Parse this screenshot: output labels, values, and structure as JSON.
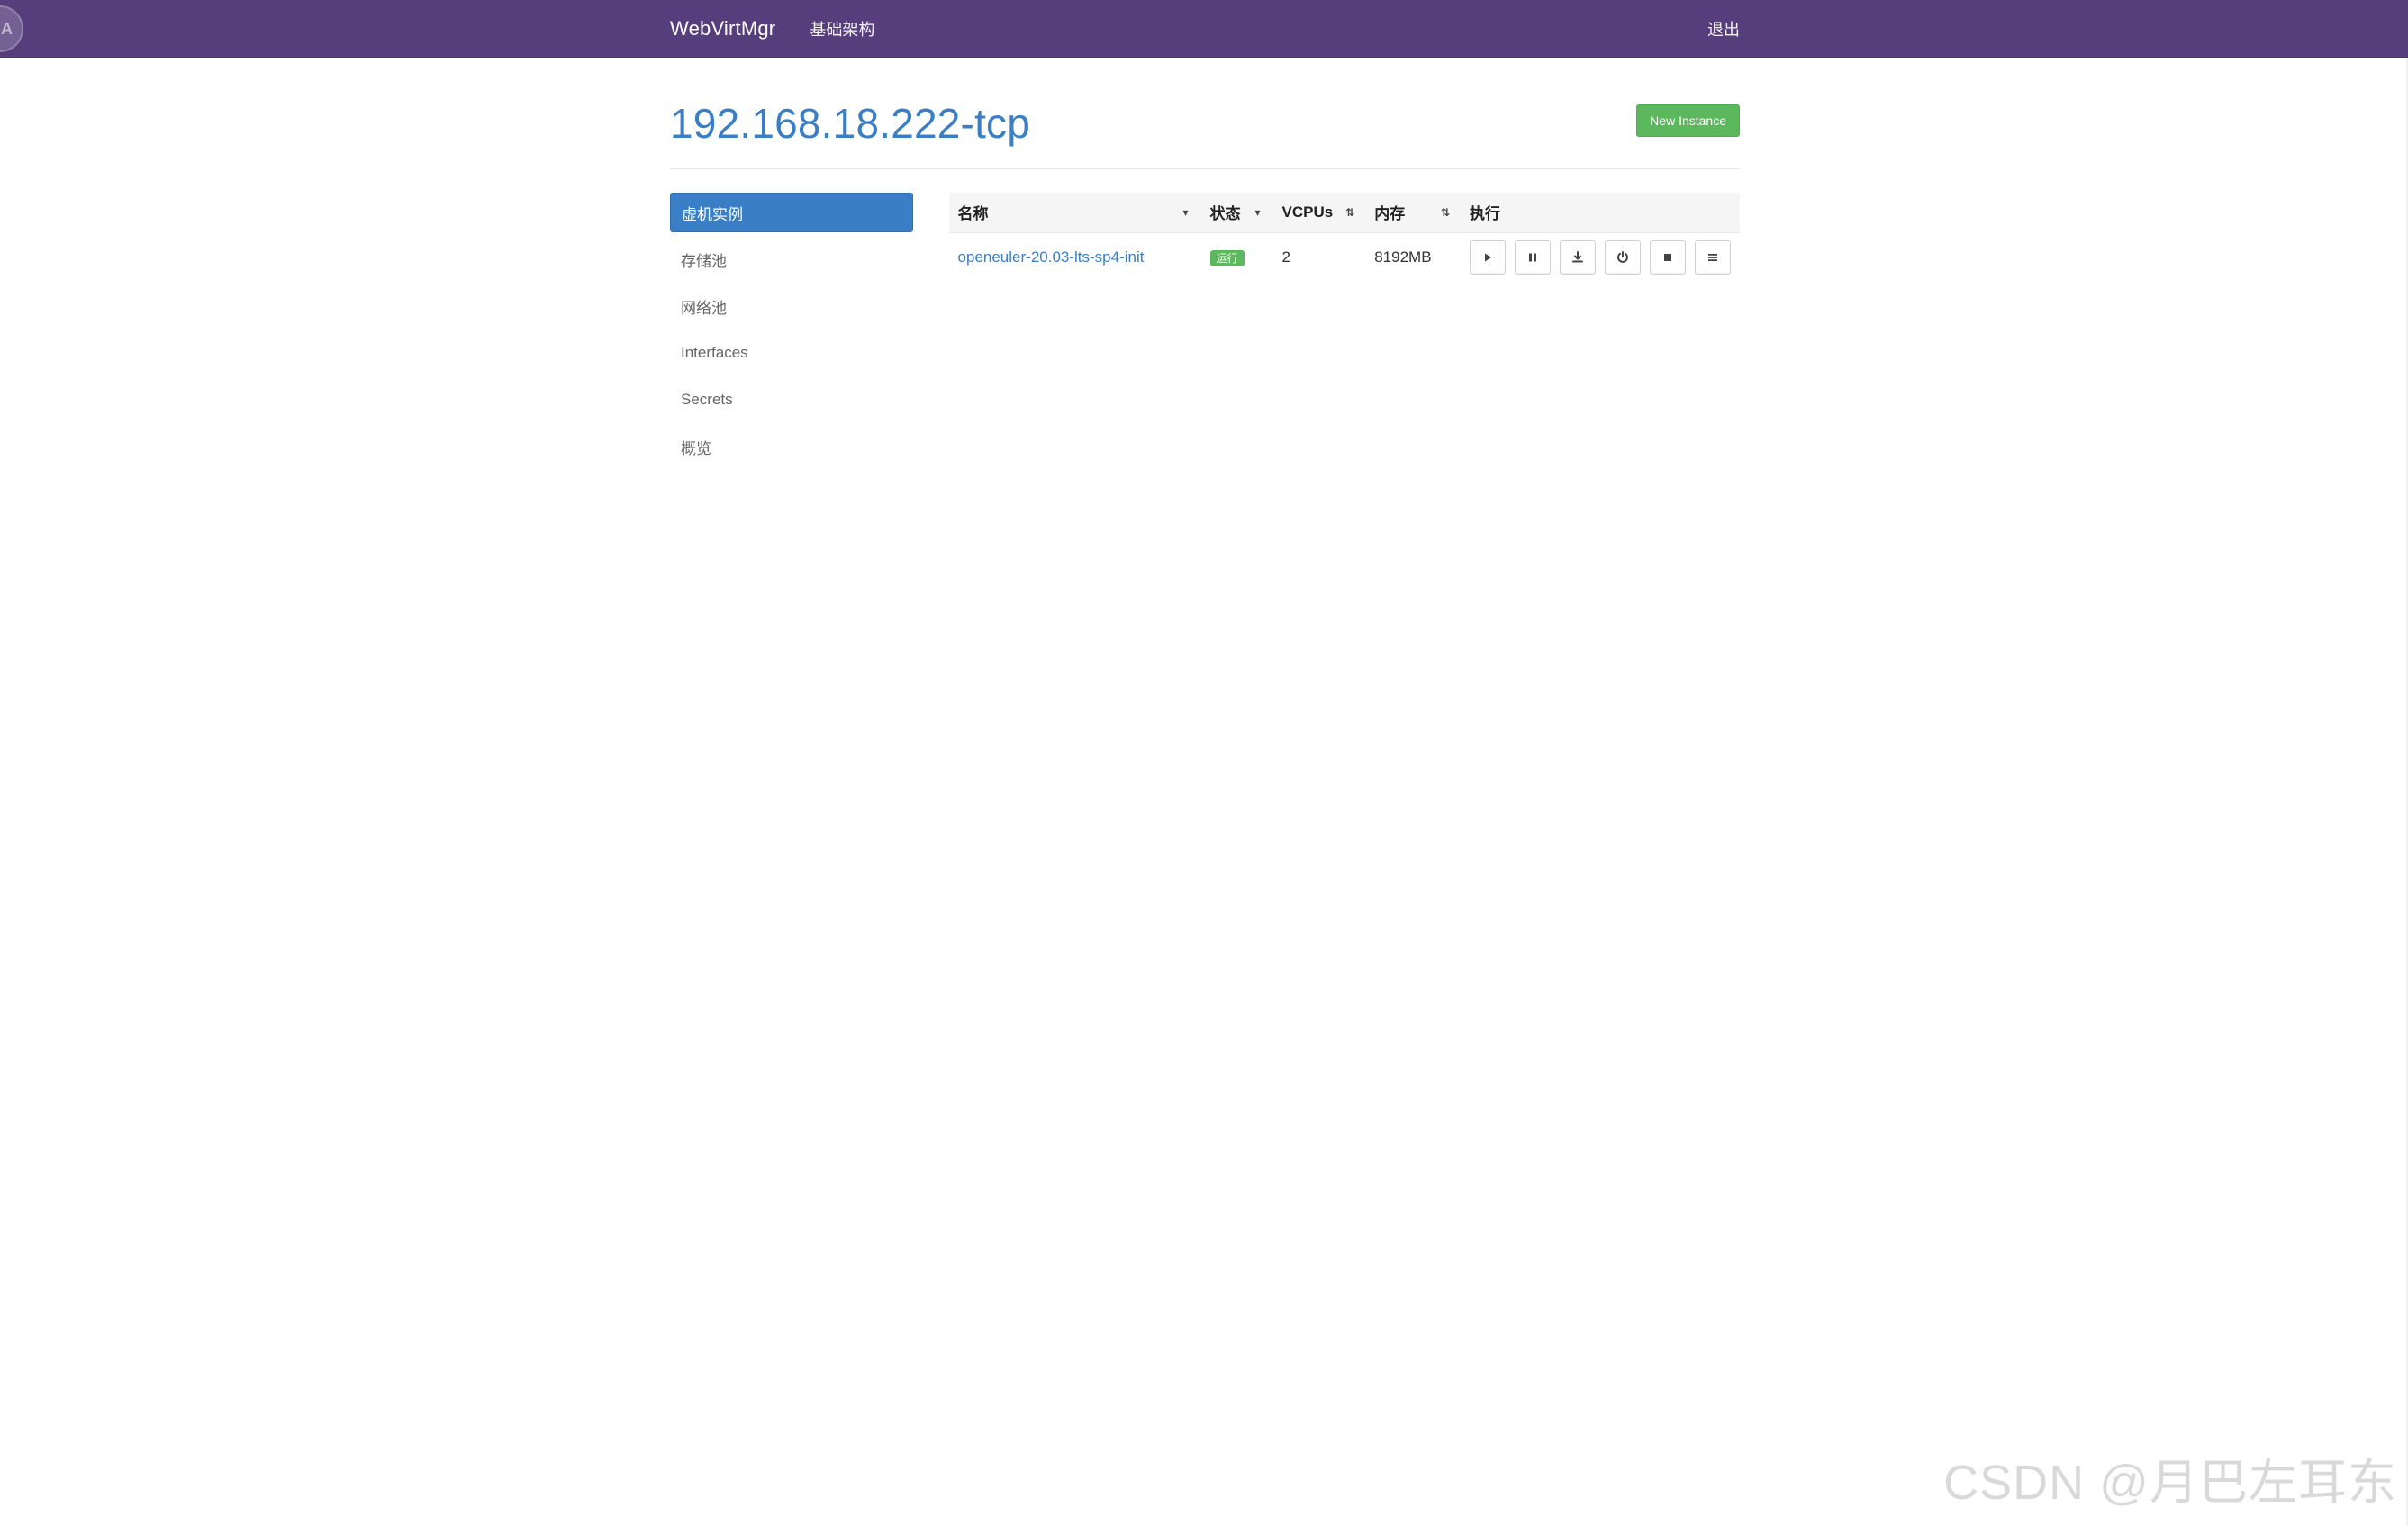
{
  "topbar": {
    "avatar_letter": "A",
    "brand": "WebVirtMgr",
    "nav_infrastructure": "基础架构",
    "nav_logout": "退出"
  },
  "header": {
    "title": "192.168.18.222-tcp",
    "new_instance_label": "New Instance"
  },
  "sidebar": {
    "items": [
      {
        "label": "虚机实例",
        "active": true
      },
      {
        "label": "存储池",
        "active": false
      },
      {
        "label": "网络池",
        "active": false
      },
      {
        "label": "Interfaces",
        "active": false
      },
      {
        "label": "Secrets",
        "active": false
      },
      {
        "label": "概览",
        "active": false
      }
    ]
  },
  "instances_table": {
    "columns": [
      "名称",
      "状态",
      "VCPUs",
      "内存",
      "执行"
    ],
    "rows": [
      {
        "name": "openeuler-20.03-lts-sp4-init",
        "status": "运行",
        "vcpus": "2",
        "memory": "8192MB",
        "actions": [
          "play-icon",
          "pause-icon",
          "download-icon",
          "power-icon",
          "stop-icon",
          "menu-icon"
        ]
      }
    ]
  },
  "watermark": "CSDN @月巴左耳东",
  "colors": {
    "navbar": "#563d7c",
    "primary": "#3a7fc5",
    "success": "#5cb85c"
  }
}
